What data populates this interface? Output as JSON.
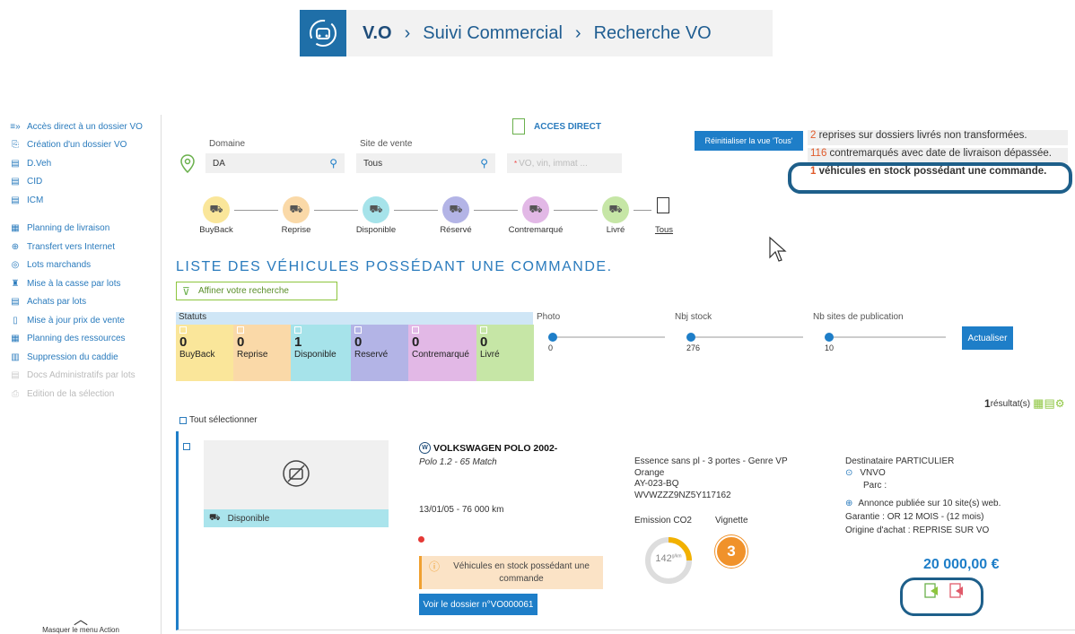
{
  "breadcrumb": {
    "root": "V.O",
    "sep": "›",
    "level1": "Suivi Commercial",
    "level2": "Recherche VO"
  },
  "sidebar": {
    "items": [
      {
        "icon": "arrow-list-icon",
        "label": "Accès direct à un dossier VO"
      },
      {
        "icon": "new-doc-icon",
        "label": "Création d'un dossier VO"
      },
      {
        "icon": "doc-icon",
        "label": "D.Veh"
      },
      {
        "icon": "doc-icon",
        "label": "CID"
      },
      {
        "icon": "doc-icon",
        "label": "ICM"
      },
      {
        "icon": "calendar-icon",
        "label": "Planning de livraison"
      },
      {
        "icon": "globe-icon",
        "label": "Transfert vers Internet"
      },
      {
        "icon": "coins-icon",
        "label": "Lots marchands"
      },
      {
        "icon": "scrap-icon",
        "label": "Mise à la casse par lots"
      },
      {
        "icon": "cart-doc-icon",
        "label": "Achats par lots"
      },
      {
        "icon": "price-icon",
        "label": "Mise à jour prix de vente"
      },
      {
        "icon": "calendar-icon",
        "label": "Planning des ressources"
      },
      {
        "icon": "trash-icon",
        "label": "Suppression du caddie"
      },
      {
        "icon": "doc-icon",
        "label": "Docs Administratifs par lots"
      },
      {
        "icon": "print-icon",
        "label": "Edition de la sélection"
      }
    ],
    "hide_label": "Masquer le menu Action"
  },
  "search": {
    "acces_direct": "ACCES DIRECT",
    "domaine_label": "Domaine",
    "domaine_value": "DA",
    "site_label": "Site de vente",
    "site_value": "Tous",
    "vo_placeholder": "VO, vin, immat ...",
    "reset_button": "Réinitialiser la vue 'Tous'"
  },
  "alerts": {
    "a1_count": "2",
    "a1_text": " reprises sur dossiers livrés non transformées.",
    "a2_count": "116",
    "a2_text": " contremarqués avec date de livraison dépassée.",
    "a3_count": "1",
    "a3_text": " véhicules en stock possédant une commande."
  },
  "steps": [
    "BuyBack",
    "Reprise",
    "Disponible",
    "Réservé",
    "Contremarqué",
    "Livré",
    "Tous"
  ],
  "list_title": "LISTE DES VÉHICULES POSSÉDANT UNE COMMANDE.",
  "filter_label": "Affiner votre recherche",
  "statuts": {
    "label": "Statuts",
    "items": [
      {
        "count": "0",
        "label": "BuyBack",
        "color": "#fae69a"
      },
      {
        "count": "0",
        "label": "Reprise",
        "color": "#fad9a8"
      },
      {
        "count": "1",
        "label": "Disponible",
        "color": "#a6e3ea"
      },
      {
        "count": "0",
        "label": "Reservé",
        "color": "#b3b4e6"
      },
      {
        "count": "0",
        "label": "Contremarqué",
        "color": "#e2b8e6"
      },
      {
        "count": "0",
        "label": "Livré",
        "color": "#c6e6a6"
      }
    ]
  },
  "sliders": [
    {
      "label": "Photo",
      "value": "0"
    },
    {
      "label": "Nbj stock",
      "value": "276"
    },
    {
      "label": "Nb sites de publication",
      "value": "10"
    }
  ],
  "actualiser": "Actualiser",
  "result": {
    "count": "1",
    "label": " résultat(s)"
  },
  "select_all": "Tout sélectionner",
  "vehicle": {
    "status": "Disponible",
    "title": "VOLKSWAGEN POLO 2002-",
    "subtitle": "Polo 1.2 - 65 Match",
    "date_km": "13/01/05 - 76 000 km",
    "warning": "Véhicules en stock possédant une commande",
    "dossier_button": "Voir le dossier n°VO000061",
    "specs": [
      "Essence sans pl - 3 portes - Genre VP",
      "Orange",
      "AY-023-BQ",
      "WVWZZZ9NZ5Y117162"
    ],
    "co2_label": "Emission CO2",
    "co2_value": "142",
    "co2_unit": "g/km",
    "vignette_label": "Vignette",
    "vignette_value": "3",
    "dest": "Destinataire PARTICULIER",
    "site": "VNVO",
    "parc": "Parc :",
    "annonce": "Annonce publiée sur 10 site(s) web.",
    "garantie": "Garantie : OR 12 MOIS - (12 mois)",
    "origine": "Origine d'achat : REPRISE SUR VO",
    "price": "20 000,00 €"
  }
}
